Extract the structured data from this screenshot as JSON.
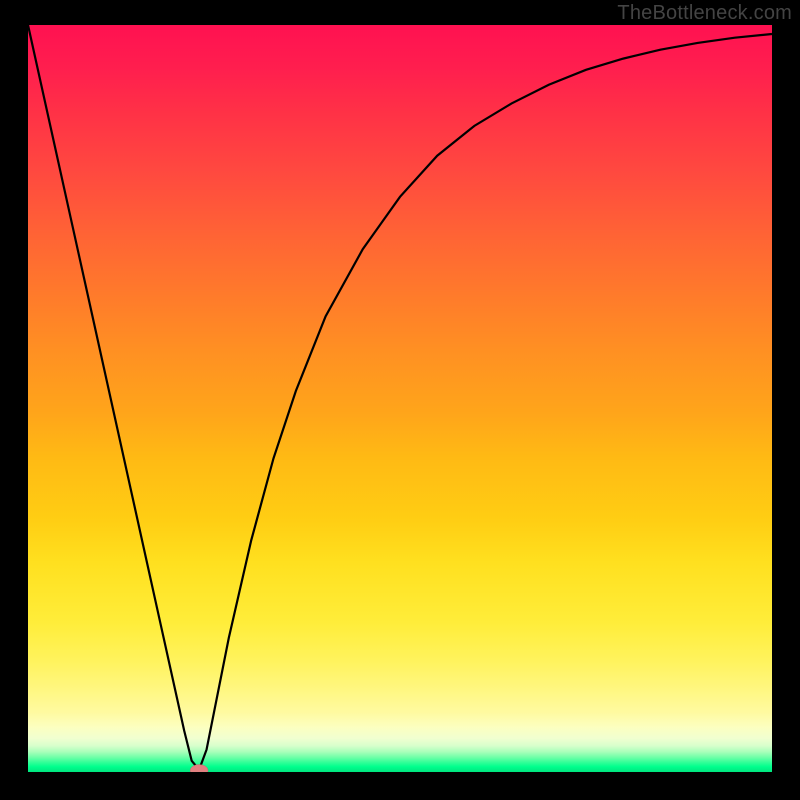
{
  "watermark": "TheBottleneck.com",
  "chart_data": {
    "type": "line",
    "title": "",
    "xlabel": "",
    "ylabel": "",
    "xlim": [
      0,
      100
    ],
    "ylim": [
      0,
      100
    ],
    "grid": false,
    "background": "vertical-gradient red→yellow→green",
    "series": [
      {
        "name": "bottleneck-curve",
        "stroke": "#000000",
        "x": [
          0,
          2,
          4,
          6,
          8,
          10,
          12,
          14,
          16,
          18,
          20,
          21,
          22,
          23,
          24,
          25,
          27,
          30,
          33,
          36,
          40,
          45,
          50,
          55,
          60,
          65,
          70,
          75,
          80,
          85,
          90,
          95,
          100
        ],
        "y": [
          100,
          91,
          82,
          73,
          64,
          55,
          46,
          37,
          28,
          19,
          10,
          5.5,
          1.5,
          0.3,
          3,
          8,
          18,
          31,
          42,
          51,
          61,
          70,
          77,
          82.5,
          86.5,
          89.5,
          92,
          94,
          95.5,
          96.7,
          97.6,
          98.3,
          98.8
        ]
      }
    ],
    "markers": [
      {
        "name": "optimum-point",
        "x": 23,
        "y": 0.2,
        "shape": "ellipse",
        "rx": 1.2,
        "ry": 0.8,
        "fill": "#e08080"
      }
    ]
  }
}
